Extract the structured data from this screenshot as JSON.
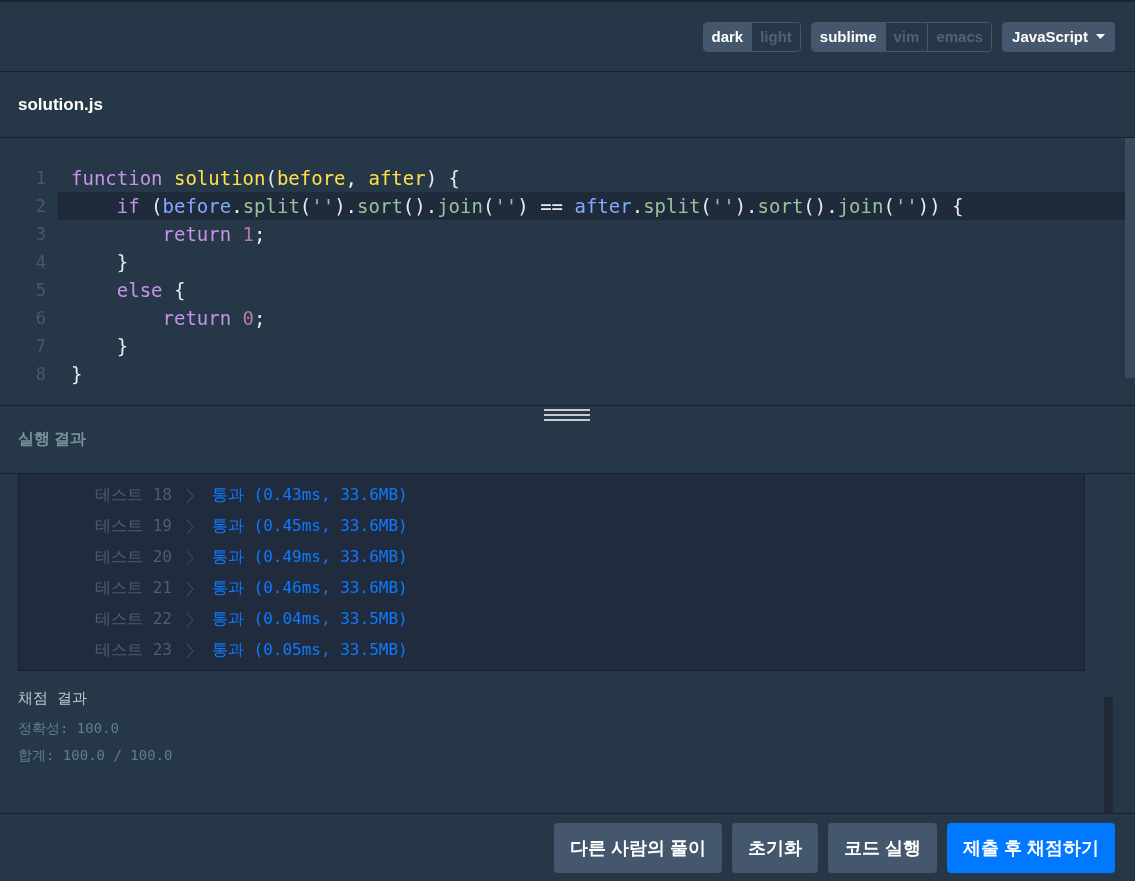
{
  "toolbar": {
    "theme_toggle": [
      {
        "label": "dark",
        "selected": true
      },
      {
        "label": "light",
        "selected": false
      }
    ],
    "keymap_toggle": [
      {
        "label": "sublime",
        "selected": true
      },
      {
        "label": "vim",
        "selected": false
      },
      {
        "label": "emacs",
        "selected": false
      }
    ],
    "language_dropdown": {
      "label": "JavaScript"
    }
  },
  "file_tab": {
    "label": "solution.js"
  },
  "editor": {
    "lines": [
      {
        "number": "1",
        "current": false,
        "tokens": [
          {
            "kind": "kw",
            "text": "function "
          },
          {
            "kind": "fn",
            "text": "solution"
          },
          {
            "kind": "plain",
            "text": "("
          },
          {
            "kind": "param",
            "text": "before"
          },
          {
            "kind": "plain",
            "text": ", "
          },
          {
            "kind": "param",
            "text": "after"
          },
          {
            "kind": "plain",
            "text": ") {"
          }
        ]
      },
      {
        "number": "2",
        "current": true,
        "tokens": [
          {
            "kind": "kw",
            "text": "    if"
          },
          {
            "kind": "plain",
            "text": " ("
          },
          {
            "kind": "var",
            "text": "before"
          },
          {
            "kind": "plain",
            "text": "."
          },
          {
            "kind": "method",
            "text": "split"
          },
          {
            "kind": "plain",
            "text": "("
          },
          {
            "kind": "str",
            "text": "''"
          },
          {
            "kind": "plain",
            "text": ")."
          },
          {
            "kind": "method",
            "text": "sort"
          },
          {
            "kind": "plain",
            "text": "()."
          },
          {
            "kind": "method",
            "text": "join"
          },
          {
            "kind": "plain",
            "text": "("
          },
          {
            "kind": "str",
            "text": "''"
          },
          {
            "kind": "plain",
            "text": ") == "
          },
          {
            "kind": "var",
            "text": "after"
          },
          {
            "kind": "plain",
            "text": "."
          },
          {
            "kind": "method",
            "text": "split"
          },
          {
            "kind": "plain",
            "text": "("
          },
          {
            "kind": "str",
            "text": "''"
          },
          {
            "kind": "plain",
            "text": ")."
          },
          {
            "kind": "method",
            "text": "sort"
          },
          {
            "kind": "plain",
            "text": "()."
          },
          {
            "kind": "method",
            "text": "join"
          },
          {
            "kind": "plain",
            "text": "("
          },
          {
            "kind": "str",
            "text": "''"
          },
          {
            "kind": "plain",
            "text": ")) {"
          }
        ]
      },
      {
        "number": "3",
        "current": false,
        "tokens": [
          {
            "kind": "kw",
            "text": "        return "
          },
          {
            "kind": "num",
            "text": "1"
          },
          {
            "kind": "plain",
            "text": ";"
          }
        ]
      },
      {
        "number": "4",
        "current": false,
        "tokens": [
          {
            "kind": "plain",
            "text": "    }"
          }
        ]
      },
      {
        "number": "5",
        "current": false,
        "tokens": [
          {
            "kind": "kw",
            "text": "    else"
          },
          {
            "kind": "plain",
            "text": " {"
          }
        ]
      },
      {
        "number": "6",
        "current": false,
        "tokens": [
          {
            "kind": "kw",
            "text": "        return "
          },
          {
            "kind": "num",
            "text": "0"
          },
          {
            "kind": "plain",
            "text": ";"
          }
        ]
      },
      {
        "number": "7",
        "current": false,
        "tokens": [
          {
            "kind": "plain",
            "text": "    }"
          }
        ]
      },
      {
        "number": "8",
        "current": false,
        "tokens": [
          {
            "kind": "plain",
            "text": "}"
          }
        ]
      }
    ]
  },
  "run_result": {
    "title": "실행 결과",
    "tests": [
      {
        "label": "테스트 18",
        "result": "통과 (0.43ms, 33.6MB)"
      },
      {
        "label": "테스트 19",
        "result": "통과 (0.45ms, 33.6MB)"
      },
      {
        "label": "테스트 20",
        "result": "통과 (0.49ms, 33.6MB)"
      },
      {
        "label": "테스트 21",
        "result": "통과 (0.46ms, 33.6MB)"
      },
      {
        "label": "테스트 22",
        "result": "통과 (0.04ms, 33.5MB)"
      },
      {
        "label": "테스트 23",
        "result": "통과 (0.05ms, 33.5MB)"
      }
    ]
  },
  "grading": {
    "title": "채점 결과",
    "lines": [
      "정확성: 100.0",
      "합계: 100.0 / 100.0"
    ]
  },
  "buttons": [
    {
      "label": "다른 사람의 풀이",
      "kind": "secondary"
    },
    {
      "label": "초기화",
      "kind": "secondary"
    },
    {
      "label": "코드 실행",
      "kind": "secondary"
    },
    {
      "label": "제출 후 채점하기",
      "kind": "primary"
    }
  ]
}
